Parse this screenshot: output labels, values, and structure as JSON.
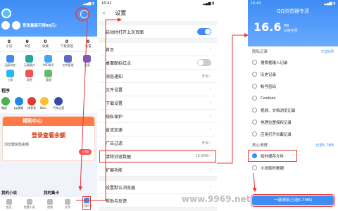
{
  "panel1": {
    "promo_text": "登录最高可得88元!",
    "stats": [
      {
        "label": "小说"
      },
      {
        "label": "书签"
      },
      {
        "label": "收藏"
      },
      {
        "label": "下载管理"
      },
      {
        "label": "设置"
      }
    ],
    "grid": [
      {
        "label": "无痕浏览"
      },
      {
        "label": "无痕模式"
      },
      {
        "label": "WiFi助手"
      },
      {
        "label": "文件管理"
      },
      {
        "label": "更多"
      },
      {
        "label": "工具"
      },
      {
        "label": "消息"
      },
      {
        "label": "管理"
      }
    ],
    "section_title": "程序",
    "apps": [
      {
        "label": "微信"
      },
      {
        "label": "pp视频"
      },
      {
        "label": "拼多多"
      },
      {
        "label": "Beer"
      },
      {
        "label": "汽车之家"
      }
    ],
    "welfare_title": "福利中心",
    "welfare_big": "登录查看余额",
    "welfare_sub": "浏览器奖励金额",
    "welfare_btn": "去领取",
    "mini_left": "我的小说",
    "mini_right": "我的集卡",
    "tabs": [
      {
        "label": "首页"
      },
      {
        "label": "免费小说"
      },
      {
        "label": "视频"
      },
      {
        "label": "文件"
      },
      {
        "label": "我的"
      }
    ]
  },
  "panel2": {
    "time": "16:42",
    "title": "设置",
    "rows_top": [
      {
        "label": "启动时打开上次页面",
        "toggle": "on"
      }
    ],
    "rows_mid": [
      {
        "label": "首页",
        "value": ""
      },
      {
        "label": "桌面图标红点",
        "toggle": "off"
      },
      {
        "label": "消息通知",
        "value": "开启 ›"
      },
      {
        "label": "文件设置",
        "value": ""
      },
      {
        "label": "下载设置",
        "value": ""
      },
      {
        "label": "隐私保护",
        "value": ""
      },
      {
        "label": "省流加速",
        "value": ""
      },
      {
        "label": "广告过滤",
        "value": "开启 ›"
      },
      {
        "label": "清除浏览数据",
        "value": "16.6MB ›",
        "highlight": true
      },
      {
        "label": "扩展功能",
        "value": ""
      }
    ],
    "rows_bottom": [
      {
        "label": "设置默认浏览器",
        "value": ""
      },
      {
        "label": "帮助与反馈",
        "value": ""
      }
    ]
  },
  "panel3": {
    "time": "16:44",
    "title": "QQ浏览器专清",
    "big_number": "16.6",
    "big_unit": "MB",
    "big_desc": "占用空间",
    "cat1": "隐私记录",
    "cat1_sel": "已选0项",
    "items1": [
      "搜索框输入记录",
      "历史记录",
      "帐号密码",
      "Cookies",
      "视频、文档浏览记录",
      "地理位置授权记录",
      "应用打开拦截记录"
    ],
    "cat2": "核心清理",
    "cat2_sel": "已选5.7MB",
    "items2": [
      {
        "label": "临时缓存文件",
        "size": "5.7",
        "checked": true,
        "highlight": true
      },
      {
        "label": "小说临时数据",
        "size": "",
        "checked": false,
        "highlight": false
      }
    ],
    "clear_btn": "一键清除(已选5.7MB)"
  },
  "watermark": "www.9969.net"
}
